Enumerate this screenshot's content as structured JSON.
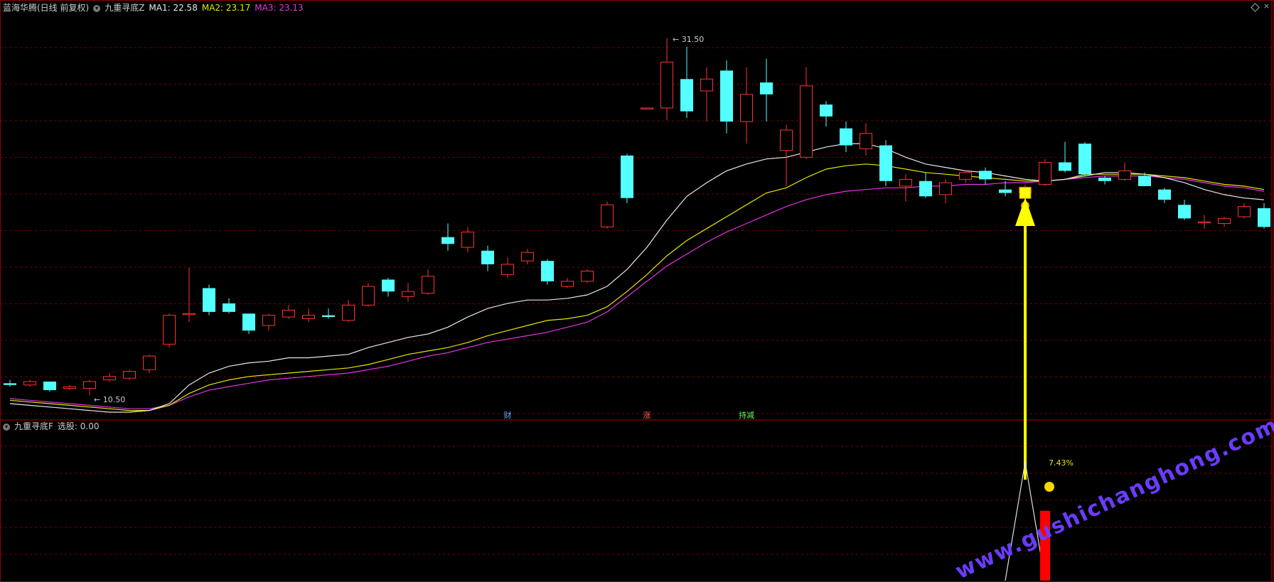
{
  "header_main": {
    "stock": "蓝海华腾(日线 前复权)",
    "indicator": "九重寻底Z",
    "ma1": "MA1: 22.58",
    "ma2": "MA2: 23.17",
    "ma3": "MA3: 23.13"
  },
  "header_sub": {
    "indicator": "九重寻底F",
    "value": "选股: 0.00"
  },
  "colors": {
    "up": "#ff3232",
    "down": "#54ffff",
    "ma1": "#e8e8e8",
    "ma2": "#e6e600",
    "ma3": "#e632e6",
    "grid": "#7a0000",
    "arrow": "#ffff00",
    "bar": "#ff0000",
    "watermark": "#6a3cff"
  },
  "chart_data": {
    "type": "candlestick",
    "price_high_label": "31.50",
    "price_low_label": "10.50",
    "ylim": [
      9.5,
      33
    ],
    "candles": [
      [
        11.2,
        11.1,
        11.4,
        11.0
      ],
      [
        11.1,
        11.3,
        11.4,
        11.0
      ],
      [
        11.3,
        10.8,
        11.3,
        10.7
      ],
      [
        10.9,
        11.0,
        11.1,
        10.8
      ],
      [
        10.9,
        11.3,
        11.4,
        10.5
      ],
      [
        11.4,
        11.6,
        11.8,
        11.3
      ],
      [
        11.5,
        11.9,
        12.0,
        11.4
      ],
      [
        12.0,
        12.8,
        12.9,
        11.8
      ],
      [
        13.5,
        15.2,
        15.3,
        13.3
      ],
      [
        15.3,
        15.3,
        18.0,
        14.8
      ],
      [
        16.8,
        15.4,
        17.0,
        15.2
      ],
      [
        15.9,
        15.4,
        16.2,
        15.3
      ],
      [
        15.3,
        14.3,
        15.3,
        14.1
      ],
      [
        14.6,
        15.2,
        15.3,
        14.3
      ],
      [
        15.1,
        15.5,
        15.8,
        15.0
      ],
      [
        15.0,
        15.2,
        15.6,
        14.8
      ],
      [
        15.2,
        15.1,
        15.6,
        15.0
      ],
      [
        14.9,
        15.8,
        16.1,
        14.8
      ],
      [
        15.8,
        16.9,
        17.1,
        15.7
      ],
      [
        17.3,
        16.6,
        17.4,
        16.3
      ],
      [
        16.3,
        16.6,
        17.1,
        16.0
      ],
      [
        16.5,
        17.5,
        17.9,
        16.4
      ],
      [
        19.8,
        19.4,
        20.6,
        19.0
      ],
      [
        19.2,
        20.1,
        20.4,
        18.9
      ],
      [
        19.0,
        18.2,
        19.3,
        17.8
      ],
      [
        17.6,
        18.2,
        18.6,
        17.4
      ],
      [
        18.4,
        18.9,
        19.1,
        18.2
      ],
      [
        18.4,
        17.2,
        18.5,
        17.0
      ],
      [
        16.9,
        17.2,
        17.4,
        16.8
      ],
      [
        17.2,
        17.8,
        17.9,
        17.1
      ],
      [
        20.4,
        21.7,
        21.9,
        20.3
      ],
      [
        24.6,
        22.1,
        24.7,
        21.8
      ],
      [
        27.4,
        27.4,
        27.4,
        27.4
      ],
      [
        27.4,
        30.1,
        31.5,
        26.7
      ],
      [
        29.1,
        27.2,
        31.0,
        26.8
      ],
      [
        28.4,
        29.1,
        29.8,
        26.6
      ],
      [
        29.6,
        26.6,
        30.2,
        25.9
      ],
      [
        26.6,
        28.2,
        29.8,
        25.3
      ],
      [
        28.9,
        28.2,
        30.3,
        26.6
      ],
      [
        24.9,
        26.1,
        26.4,
        22.8
      ],
      [
        24.5,
        28.7,
        29.8,
        24.4
      ],
      [
        27.6,
        26.9,
        27.8,
        26.3
      ],
      [
        26.2,
        25.2,
        26.6,
        24.8
      ],
      [
        25.0,
        25.9,
        26.5,
        24.6
      ],
      [
        25.2,
        23.1,
        25.5,
        22.8
      ],
      [
        22.8,
        23.2,
        23.5,
        21.9
      ],
      [
        23.1,
        22.2,
        23.6,
        22.1
      ],
      [
        22.3,
        23.0,
        23.2,
        21.8
      ],
      [
        23.2,
        23.6,
        23.7,
        23.0
      ],
      [
        23.7,
        23.2,
        23.9,
        22.9
      ],
      [
        22.6,
        22.4,
        23.1,
        22.2
      ],
      [
        22.4,
        22.7,
        22.9,
        22.3
      ],
      [
        22.9,
        24.2,
        24.4,
        22.8
      ],
      [
        24.2,
        23.7,
        25.4,
        23.6
      ],
      [
        25.3,
        23.5,
        25.4,
        23.4
      ],
      [
        23.3,
        23.1,
        23.4,
        22.9
      ],
      [
        23.2,
        23.7,
        24.2,
        23.1
      ],
      [
        23.4,
        22.8,
        23.6,
        22.8
      ],
      [
        22.6,
        22.0,
        22.7,
        21.8
      ],
      [
        21.7,
        20.9,
        22.0,
        20.8
      ],
      [
        20.7,
        20.7,
        21.1,
        20.3
      ],
      [
        20.6,
        20.9,
        21.0,
        20.4
      ],
      [
        21.0,
        21.6,
        21.8,
        20.9
      ],
      [
        21.5,
        20.4,
        21.8,
        20.3
      ]
    ],
    "ma1": [
      10.0,
      9.9,
      9.8,
      9.7,
      9.6,
      9.5,
      9.5,
      9.6,
      10.0,
      11.1,
      11.8,
      12.2,
      12.4,
      12.5,
      12.7,
      12.7,
      12.8,
      12.9,
      13.3,
      13.6,
      13.9,
      14.1,
      14.5,
      15.1,
      15.6,
      15.9,
      16.1,
      16.1,
      16.2,
      16.4,
      16.9,
      17.9,
      19.2,
      20.8,
      22.2,
      23.0,
      23.7,
      24.1,
      24.4,
      24.5,
      24.8,
      25.1,
      25.3,
      25.3,
      25.0,
      24.5,
      24.1,
      23.9,
      23.7,
      23.6,
      23.4,
      23.2,
      23.1,
      23.2,
      23.4,
      23.6,
      23.6,
      23.5,
      23.3,
      23.0,
      22.6,
      22.3,
      22.1,
      22.0
    ],
    "ma2": [
      10.2,
      10.1,
      10.0,
      9.9,
      9.8,
      9.7,
      9.6,
      9.6,
      9.9,
      10.6,
      11.1,
      11.4,
      11.6,
      11.7,
      11.8,
      11.9,
      12.0,
      12.1,
      12.3,
      12.6,
      12.9,
      13.1,
      13.3,
      13.6,
      14.0,
      14.3,
      14.6,
      14.9,
      15.0,
      15.2,
      15.7,
      16.6,
      17.6,
      18.7,
      19.6,
      20.3,
      21.0,
      21.7,
      22.4,
      22.7,
      23.3,
      23.8,
      24.0,
      24.1,
      24.0,
      23.8,
      23.6,
      23.5,
      23.4,
      23.3,
      23.2,
      23.1,
      23.1,
      23.2,
      23.5,
      23.5,
      23.5,
      23.5,
      23.4,
      23.3,
      23.1,
      22.9,
      22.8,
      22.6
    ],
    "ma3": [
      10.3,
      10.2,
      10.1,
      10.0,
      9.9,
      9.8,
      9.7,
      9.7,
      9.9,
      10.4,
      10.8,
      11.0,
      11.2,
      11.4,
      11.5,
      11.6,
      11.7,
      11.8,
      12.0,
      12.2,
      12.5,
      12.8,
      13.0,
      13.3,
      13.6,
      13.8,
      14.0,
      14.2,
      14.5,
      14.8,
      15.4,
      16.3,
      17.2,
      18.1,
      18.8,
      19.5,
      20.1,
      20.6,
      21.1,
      21.6,
      22.0,
      22.3,
      22.5,
      22.6,
      22.7,
      22.7,
      22.8,
      22.8,
      22.9,
      22.9,
      23.0,
      23.0,
      23.1,
      23.2,
      23.3,
      23.4,
      23.4,
      23.4,
      23.3,
      23.2,
      23.0,
      22.8,
      22.7,
      22.5
    ],
    "text_labels": [
      {
        "text": "财",
        "index": 25,
        "color": "#6aa6ff"
      },
      {
        "text": "涨",
        "index": 32,
        "color": "#ff5a5a"
      },
      {
        "text": "持减",
        "index": 37,
        "color": "#5aff5a"
      }
    ],
    "signal_index": 51,
    "signal_percent": "7.43%",
    "sub_ylim": [
      0,
      1
    ],
    "sub_line": [
      {
        "index": 50,
        "value": 0
      },
      {
        "index": 51,
        "value": 0.8
      },
      {
        "index": 52,
        "value": 0
      }
    ],
    "sub_bar": {
      "index": 52,
      "value": 0.47
    }
  },
  "watermark": "www.gushichanghong.com"
}
